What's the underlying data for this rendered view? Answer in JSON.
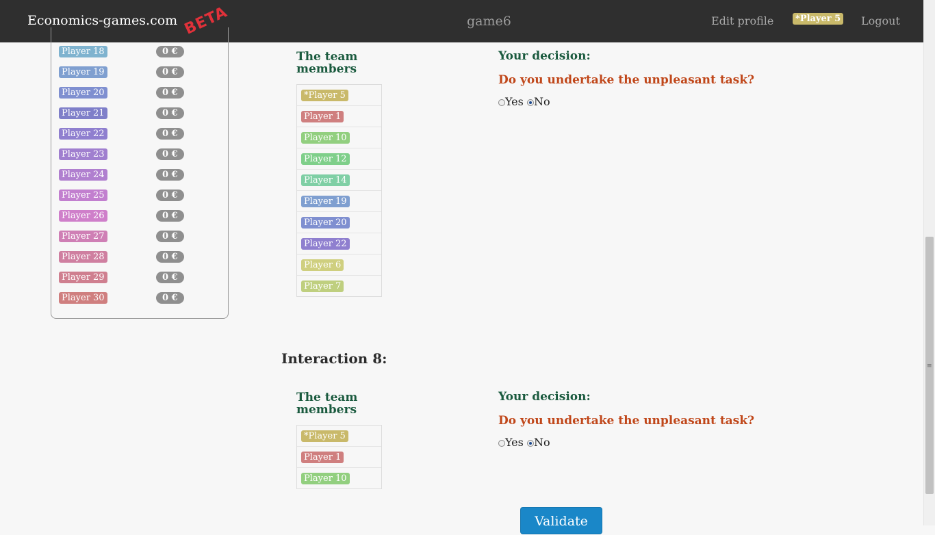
{
  "navbar": {
    "brand": "Economics-games.com",
    "beta": "BETA",
    "game": "game6",
    "edit_profile": "Edit profile",
    "current_player": "*Player 5",
    "logout": "Logout"
  },
  "scoreboard": {
    "rows": [
      {
        "name": "Player 18",
        "amount": "0 €",
        "color": "#7fb3cf"
      },
      {
        "name": "Player 19",
        "amount": "0 €",
        "color": "#7f9fd0"
      },
      {
        "name": "Player 20",
        "amount": "0 €",
        "color": "#7f8fd0"
      },
      {
        "name": "Player 21",
        "amount": "0 €",
        "color": "#7f7fc9"
      },
      {
        "name": "Player 22",
        "amount": "0 €",
        "color": "#8f7fcf"
      },
      {
        "name": "Player 23",
        "amount": "0 €",
        "color": "#a07fcf"
      },
      {
        "name": "Player 24",
        "amount": "0 €",
        "color": "#b07fcf"
      },
      {
        "name": "Player 25",
        "amount": "0 €",
        "color": "#c27fcf"
      },
      {
        "name": "Player 26",
        "amount": "0 €",
        "color": "#cf7fca"
      },
      {
        "name": "Player 27",
        "amount": "0 €",
        "color": "#cf7fb5"
      },
      {
        "name": "Player 28",
        "amount": "0 €",
        "color": "#cf7fa0"
      },
      {
        "name": "Player 29",
        "amount": "0 €",
        "color": "#cf7f8f"
      },
      {
        "name": "Player 30",
        "amount": "0 €",
        "color": "#cf7f7f"
      }
    ]
  },
  "interaction7": {
    "team_heading_line1": "The team",
    "team_heading_line2": "members",
    "members": [
      {
        "name": "*Player 5",
        "color": "#c9b96a"
      },
      {
        "name": "Player 1",
        "color": "#cf7f7f"
      },
      {
        "name": "Player 10",
        "color": "#92cf7f"
      },
      {
        "name": "Player 12",
        "color": "#7fcf8a"
      },
      {
        "name": "Player 14",
        "color": "#7fcfa5"
      },
      {
        "name": "Player 19",
        "color": "#7f9fd0"
      },
      {
        "name": "Player 20",
        "color": "#7f8fd0"
      },
      {
        "name": "Player 22",
        "color": "#8f7fcf"
      },
      {
        "name": "Player 6",
        "color": "#cfcf7f"
      },
      {
        "name": "Player 7",
        "color": "#bfcf7f"
      }
    ],
    "decision_title": "Your decision:",
    "question": "Do you undertake the unpleasant task?",
    "yes": "Yes",
    "no": "No"
  },
  "interaction8": {
    "title": "Interaction 8:",
    "team_heading_line1": "The team",
    "team_heading_line2": "members",
    "members": [
      {
        "name": "*Player 5",
        "color": "#c9b96a"
      },
      {
        "name": "Player 1",
        "color": "#cf7f7f"
      },
      {
        "name": "Player 10",
        "color": "#92cf7f"
      }
    ],
    "decision_title": "Your decision:",
    "question": "Do you undertake the unpleasant task?",
    "yes": "Yes",
    "no": "No"
  },
  "validate_label": "Validate"
}
